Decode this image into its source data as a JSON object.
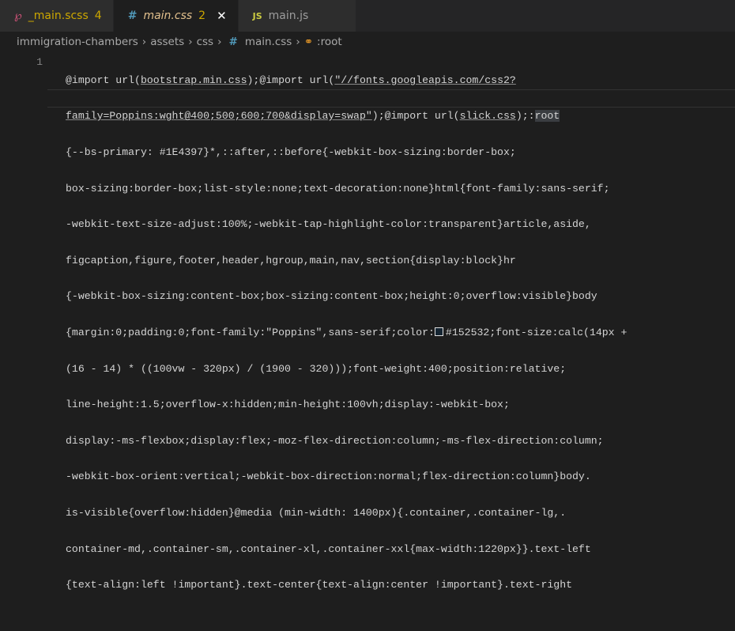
{
  "tabs": [
    {
      "label": "_main.scss",
      "problems": "4",
      "icon": "sass-icon"
    },
    {
      "label": "main.css",
      "problems": "2",
      "icon": "css-hash-icon",
      "active": true
    },
    {
      "label": "main.js",
      "icon": "js-icon"
    }
  ],
  "breadcrumb": [
    "immigration-chambers",
    "assets",
    "css",
    "main.css",
    ":root"
  ],
  "editor": {
    "line_number": "1",
    "lines": [
      [
        "@import url(",
        "bootstrap.min.css",
        ");@import url(",
        "\"//fonts.googleapis.com/css2?"
      ],
      [
        "family=Poppins:wght@400;500;600;700&display=swap\"",
        ");@import url(",
        "slick.css",
        ");:",
        "root"
      ],
      [
        "{--bs-primary: #1E4397}*,::after,::before{-webkit-box-sizing:border-box;"
      ],
      [
        "box-sizing:border-box;list-style:none;text-decoration:none}html{font-family:sans-serif;"
      ],
      [
        "-webkit-text-size-adjust:100%;-webkit-tap-highlight-color:transparent}article,aside,"
      ],
      [
        "figcaption,figure,footer,header,hgroup,main,nav,section{display:block}hr"
      ],
      [
        "{-webkit-box-sizing:content-box;box-sizing:content-box;height:0;overflow:visible}body"
      ],
      [
        "{margin:0;padding:0;font-family:\"Poppins\",sans-serif;color:",
        "#152532;font-size:calc(14px +"
      ],
      [
        "(16 - 14) * ((100vw - 320px) / (1900 - 320)));font-weight:400;position:relative;"
      ],
      [
        "line-height:1.5;overflow-x:hidden;min-height:100vh;display:-webkit-box;"
      ],
      [
        "display:-ms-flexbox;display:flex;-moz-flex-direction:column;-ms-flex-direction:column;"
      ],
      [
        "-webkit-box-orient:vertical;-webkit-box-direction:normal;flex-direction:column}body."
      ],
      [
        "is-visible{overflow:hidden}@media (min-width: 1400px){.container,.container-lg,."
      ],
      [
        "container-md,.container-sm,.container-xl,.container-xxl{max-width:1220px}}.text-left"
      ],
      [
        "{text-align:left !important}.text-center{text-align:center !important}.text-right"
      ]
    ]
  },
  "colors": {
    "swatch": "#152532",
    "bg": "#1e1e1e"
  }
}
